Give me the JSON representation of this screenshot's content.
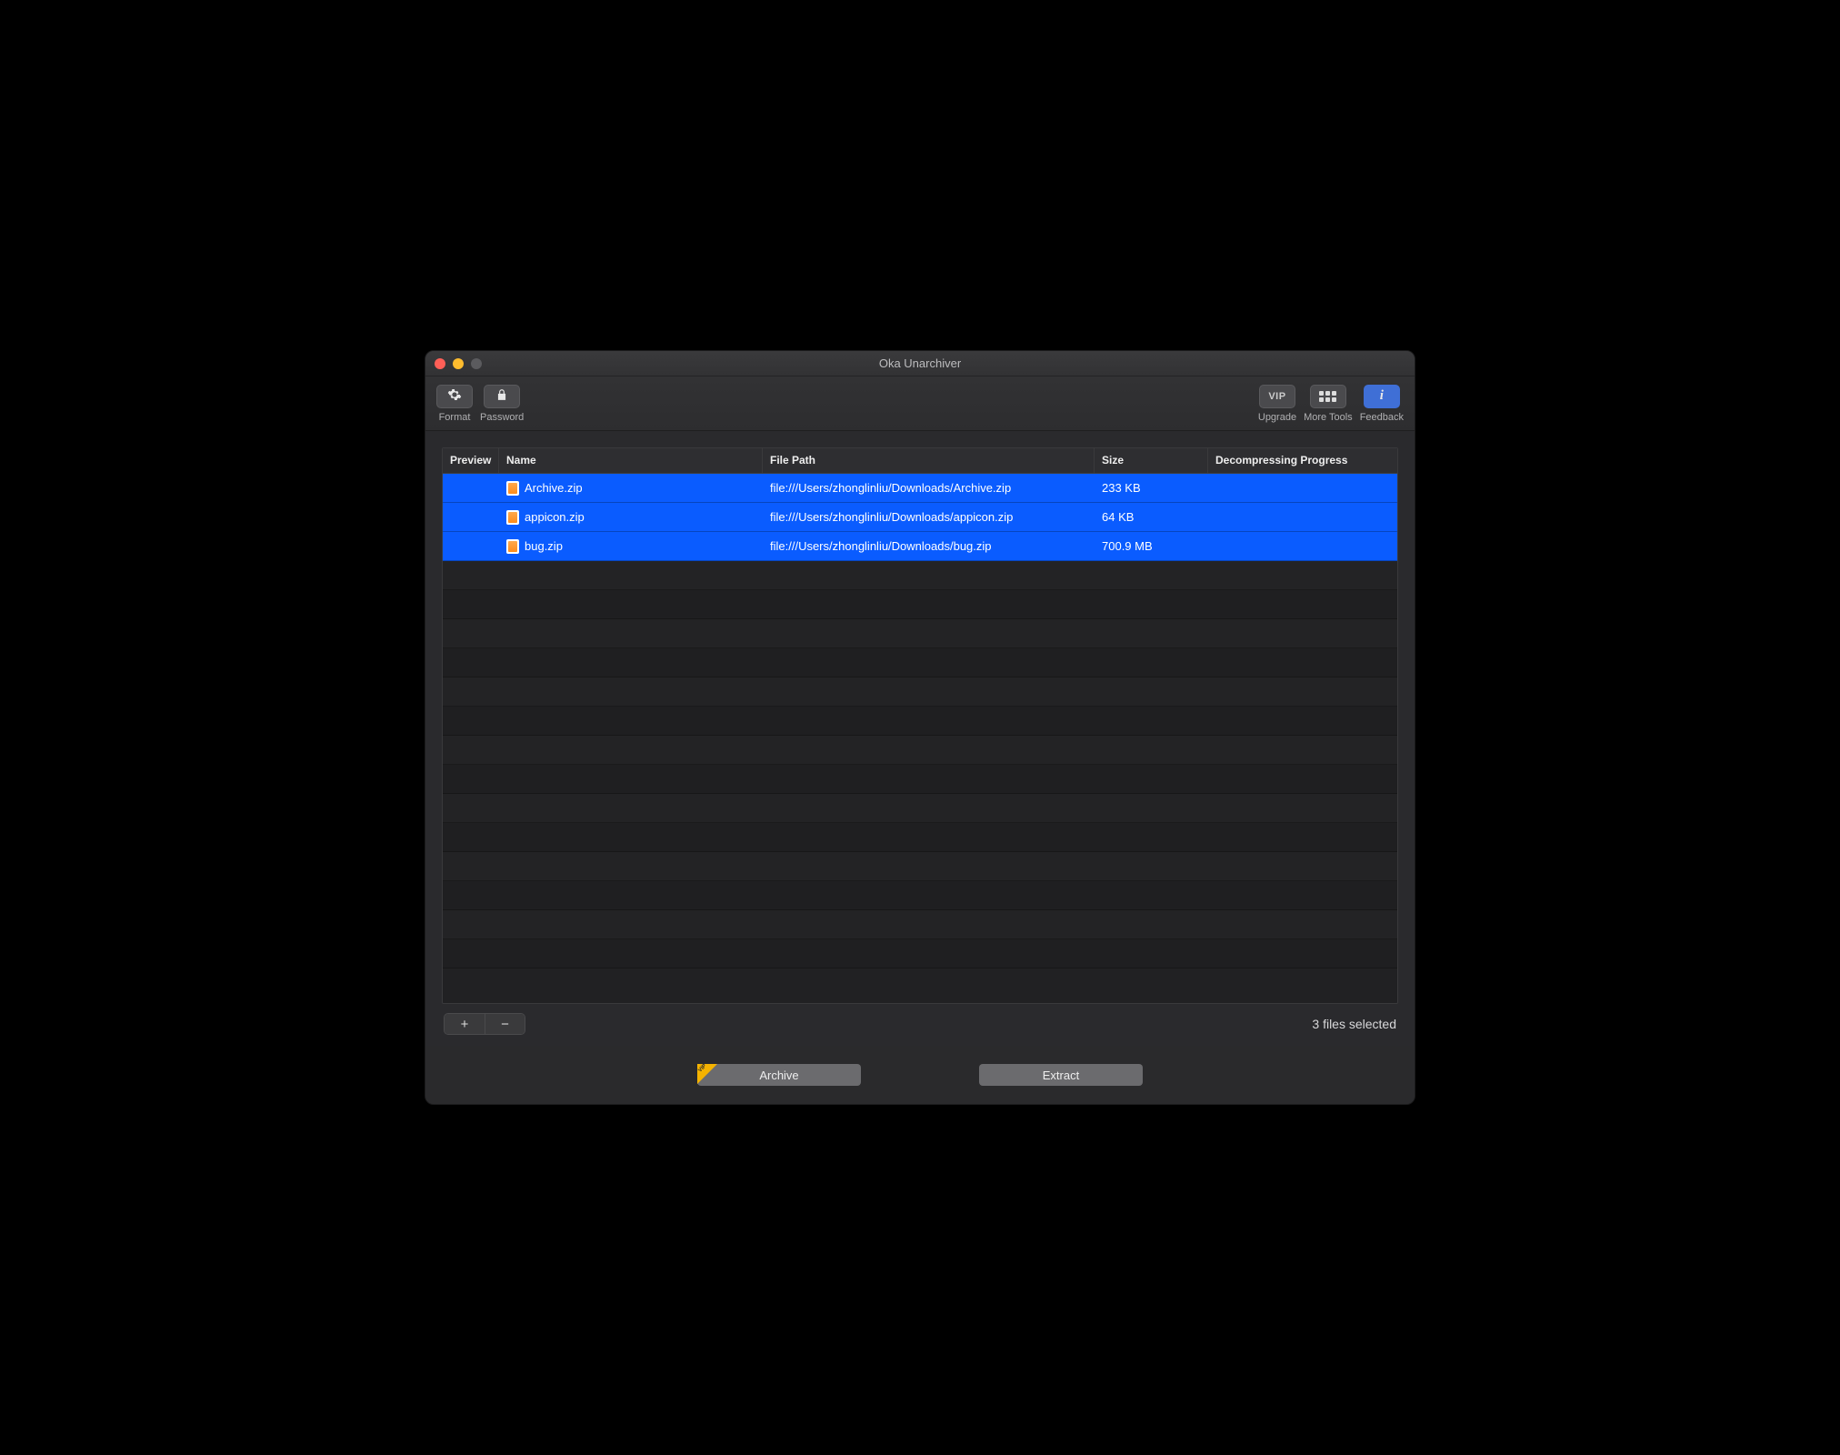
{
  "window": {
    "title": "Oka Unarchiver"
  },
  "toolbar": {
    "format_label": "Format",
    "password_label": "Password",
    "upgrade_label": "Upgrade",
    "vip_text": "VIP",
    "more_tools_label": "More Tools",
    "feedback_label": "Feedback"
  },
  "columns": {
    "preview": "Preview",
    "name": "Name",
    "path": "File Path",
    "size": "Size",
    "progress": "Decompressing Progress"
  },
  "rows": [
    {
      "name": "Archive.zip",
      "path": "file:///Users/zhonglinliu/Downloads/Archive.zip",
      "size": "233 KB",
      "selected": true
    },
    {
      "name": "appicon.zip",
      "path": "file:///Users/zhonglinliu/Downloads/appicon.zip",
      "size": "64 KB",
      "selected": true
    },
    {
      "name": "bug.zip",
      "path": "file:///Users/zhonglinliu/Downloads/bug.zip",
      "size": "700.9 MB",
      "selected": true
    }
  ],
  "status": "3 files selected",
  "buttons": {
    "archive": "Archive",
    "extract": "Extract",
    "vip_badge": "VIP"
  }
}
